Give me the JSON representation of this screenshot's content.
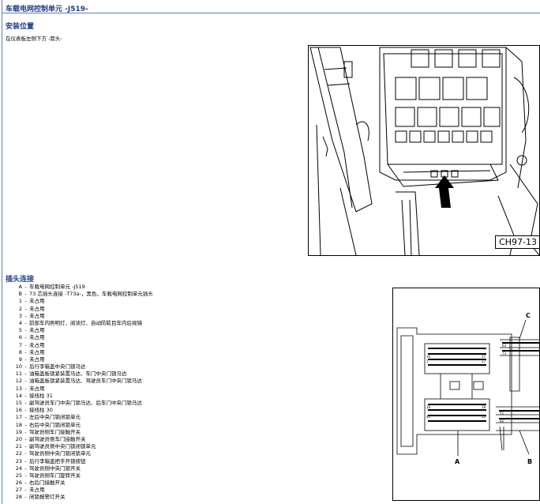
{
  "header": {
    "title": "车载电网控制单元 -J519-"
  },
  "installation": {
    "heading": "安装位置",
    "text": "在仪表板左侧下方 -箭头-",
    "figure_code": "CH97-13"
  },
  "connector": {
    "heading": "插头连接",
    "items": [
      {
        "id": "A",
        "text": "车载电网控制单元 -J519"
      },
      {
        "id": "B",
        "text": "73 芯插头连接 -T73a-，黑色，车载电网控制单元插头"
      },
      {
        "id": "1",
        "text": "未占用"
      },
      {
        "id": "2",
        "text": "未占用"
      },
      {
        "id": "3",
        "text": "未占用"
      },
      {
        "id": "4",
        "text": "前部车内照明灯、阅读灯、自动防眩目车内后视镜"
      },
      {
        "id": "5",
        "text": "未占用"
      },
      {
        "id": "6",
        "text": "未占用"
      },
      {
        "id": "7",
        "text": "未占用"
      },
      {
        "id": "8",
        "text": "未占用"
      },
      {
        "id": "9",
        "text": "未占用"
      },
      {
        "id": "10",
        "text": "后行李箱盖中央门锁马达"
      },
      {
        "id": "11",
        "text": "油箱盖板锁紧装置马达、车门中央门锁马达"
      },
      {
        "id": "12",
        "text": "油箱盖板锁紧装置马达、驾驶员车门中央门锁马达"
      },
      {
        "id": "13",
        "text": "未占用"
      },
      {
        "id": "14",
        "text": "接线柱 31"
      },
      {
        "id": "15",
        "text": "副驾驶员车门中央门锁马达、后车门中央门锁马达"
      },
      {
        "id": "16",
        "text": "接线柱 30"
      },
      {
        "id": "17",
        "text": "左后中央门锁闭锁单元"
      },
      {
        "id": "18",
        "text": "右后中央门锁闭锁单元"
      },
      {
        "id": "19",
        "text": "驾驶员侧车门接触开关"
      },
      {
        "id": "20",
        "text": "副驾驶员侧车门接触开关"
      },
      {
        "id": "21",
        "text": "副驾驶员侧中央门锁闭锁单元"
      },
      {
        "id": "22",
        "text": "驾驶员侧中央门锁闭锁单元"
      },
      {
        "id": "23",
        "text": "后行李箱盖把手开锁按钮"
      },
      {
        "id": "24",
        "text": "驾驶员侧中央门锁开关"
      },
      {
        "id": "25",
        "text": "驾驶员侧车门旋转开关"
      },
      {
        "id": "26",
        "text": "右后门接触开关"
      },
      {
        "id": "27",
        "text": "未占用"
      },
      {
        "id": "28",
        "text": "闭锁报警灯开关"
      }
    ],
    "figure_labels": {
      "A": "A",
      "B": "B",
      "C": "C",
      "pins": [
        "16",
        "37",
        "1",
        "17",
        "18",
        "38",
        "42",
        "53",
        "55",
        "60",
        "63",
        "73"
      ]
    }
  }
}
